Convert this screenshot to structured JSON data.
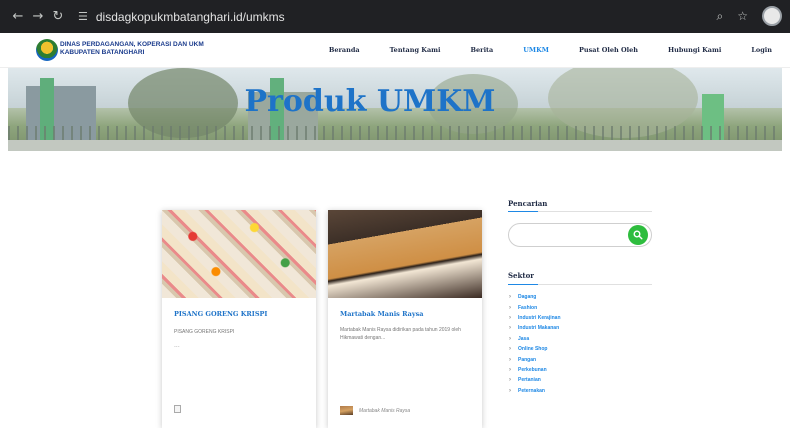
{
  "browser": {
    "url": "disdagkopukmbatanghari.id/umkms",
    "icons": [
      "back-icon",
      "forward-icon",
      "reload-icon",
      "site-settings-icon",
      "zoom-icon",
      "bookmark-star-icon",
      "profile-avatar"
    ]
  },
  "header": {
    "brand_line1": "DINAS PERDAGANGAN, KOPERASI DAN UKM",
    "brand_line2": "KABUPATEN BATANGHARI",
    "menu": [
      "Beranda",
      "Tentang Kami",
      "Berita",
      "UMKM",
      "Pusat Oleh Oleh",
      "Hubungi Kami",
      "Login"
    ],
    "active_menu": "UMKM"
  },
  "hero": {
    "title": "Produk UMKM"
  },
  "products": [
    {
      "title": "PISANG GORENG KRISPI",
      "desc": "PISANG GORENG KRISPI",
      "extra": "...",
      "author": ""
    },
    {
      "title": "Martabak Manis Raysa",
      "desc": "Martabak Manis Raysa didirikan pada tahun 2019 oleh Hikmawati dengan...",
      "extra": "",
      "author": "Martabak Manis Raysa"
    }
  ],
  "sidebar": {
    "search_heading": "Pencarian",
    "search_placeholder": "",
    "sektor_heading": "Sektor",
    "sektor_items": [
      "Dagang",
      "Fashion",
      "Industri Kerajinan",
      "Industri Makanan",
      "Jasa",
      "Online Shop",
      "Pangan",
      "Perkebunan",
      "Pertanian",
      "Peternakan"
    ]
  },
  "colors": {
    "accent": "#1e88e5",
    "search_button": "#2ebd3e",
    "chrome": "#202124"
  }
}
